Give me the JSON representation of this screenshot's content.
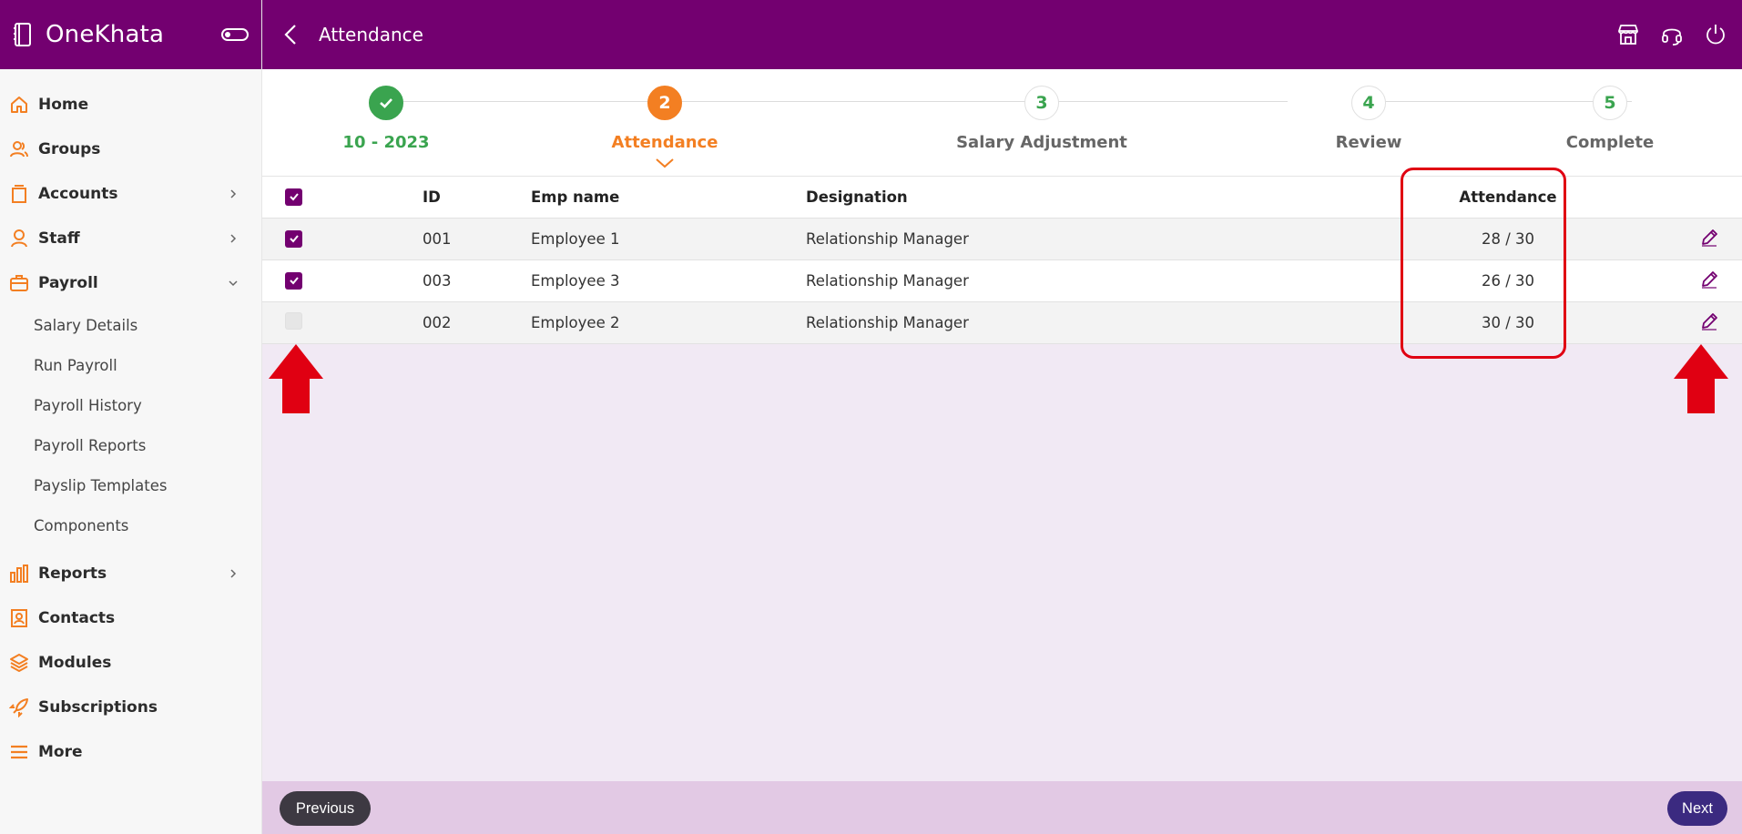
{
  "brand": {
    "name": "OneKhata"
  },
  "header": {
    "title": "Attendance"
  },
  "sidebar": {
    "items": [
      {
        "label": "Home"
      },
      {
        "label": "Groups"
      },
      {
        "label": "Accounts"
      },
      {
        "label": "Staff"
      },
      {
        "label": "Payroll"
      },
      {
        "label": "Reports"
      },
      {
        "label": "Contacts"
      },
      {
        "label": "Modules"
      },
      {
        "label": "Subscriptions"
      },
      {
        "label": "More"
      }
    ],
    "payroll_sub": [
      {
        "label": "Salary Details"
      },
      {
        "label": "Run Payroll"
      },
      {
        "label": "Payroll History"
      },
      {
        "label": "Payroll Reports"
      },
      {
        "label": "Payslip Templates"
      },
      {
        "label": "Components"
      }
    ]
  },
  "stepper": {
    "steps": [
      {
        "number": "",
        "label": "10 - 2023",
        "state": "done"
      },
      {
        "number": "2",
        "label": "Attendance",
        "state": "active"
      },
      {
        "number": "3",
        "label": "Salary Adjustment",
        "state": "pending"
      },
      {
        "number": "4",
        "label": "Review",
        "state": "pending"
      },
      {
        "number": "5",
        "label": "Complete",
        "state": "pending"
      }
    ]
  },
  "table": {
    "headers": {
      "id": "ID",
      "name": "Emp name",
      "designation": "Designation",
      "attendance": "Attendance"
    },
    "rows": [
      {
        "checked": true,
        "id": "001",
        "name": "Employee 1",
        "designation": "Relationship Manager",
        "attendance": "28 / 30"
      },
      {
        "checked": true,
        "id": "003",
        "name": "Employee 3",
        "designation": "Relationship Manager",
        "attendance": "26 / 30"
      },
      {
        "checked": false,
        "id": "002",
        "name": "Employee 2",
        "designation": "Relationship Manager",
        "attendance": "30 / 30"
      }
    ]
  },
  "footer": {
    "previous_label": "Previous",
    "next_label": "Next"
  },
  "colors": {
    "brand": "#730070",
    "done": "#3aa44f",
    "active": "#f37f22",
    "highlight": "#e00012"
  }
}
